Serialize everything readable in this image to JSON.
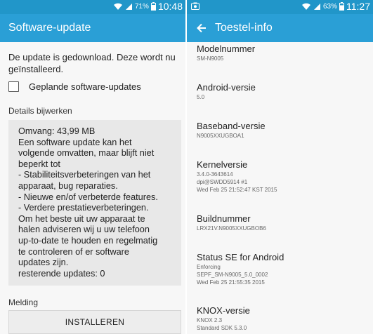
{
  "left": {
    "status": {
      "battery": "71%",
      "time": "10:48"
    },
    "title": "Software-update",
    "message": "De update is gedownload. Deze wordt nu geïnstalleerd.",
    "checkbox_label": "Geplande software-updates",
    "details_title": "Details bijwerken",
    "details_lines": [
      "Omvang: 43,99 MB",
      "Een software update kan het",
      "volgende omvatten, maar blijft niet",
      "beperkt tot",
      " - Stabiliteitsverbeteringen van het",
      "apparaat, bug reparaties.",
      " - Nieuwe en/of verbeterde features.",
      " - Verdere prestatieverbeteringen.",
      "Om het beste uit uw apparaat te",
      "halen adviseren wij u uw telefoon",
      "up-to-date te houden en regelmatig",
      "te controleren of er software",
      "updates zijn.",
      "resterende updates: 0"
    ],
    "notification_title": "Melding",
    "install_button": "INSTALLEREN"
  },
  "right": {
    "status": {
      "battery": "63%",
      "time": "11:27"
    },
    "title": "Toestel-info",
    "items": [
      {
        "label": "Modelnummer",
        "values": [
          "SM-N9005"
        ]
      },
      {
        "label": "Android-versie",
        "values": [
          "5.0"
        ]
      },
      {
        "label": "Baseband-versie",
        "values": [
          "N9005XXUGBOA1"
        ]
      },
      {
        "label": "Kernelversie",
        "values": [
          "3.4.0-3643614",
          "dpi@SWDD5914 #1",
          "Wed Feb 25 21:52:47 KST 2015"
        ]
      },
      {
        "label": "Buildnummer",
        "values": [
          "LRX21V.N9005XXUGBOB6"
        ]
      },
      {
        "label": "Status SE for Android",
        "values": [
          "Enforcing",
          "SEPF_SM-N9005_5.0_0002",
          "Wed Feb 25 21:55:35 2015"
        ]
      },
      {
        "label": "KNOX-versie",
        "values": [
          "KNOX 2.3",
          "Standard SDK 5.3.0"
        ]
      }
    ]
  },
  "colors": {
    "statusbar": "#2196c9",
    "appbar": "#2a9fd6",
    "background": "#f7f7f7",
    "details_box": "#e8e8e8"
  }
}
